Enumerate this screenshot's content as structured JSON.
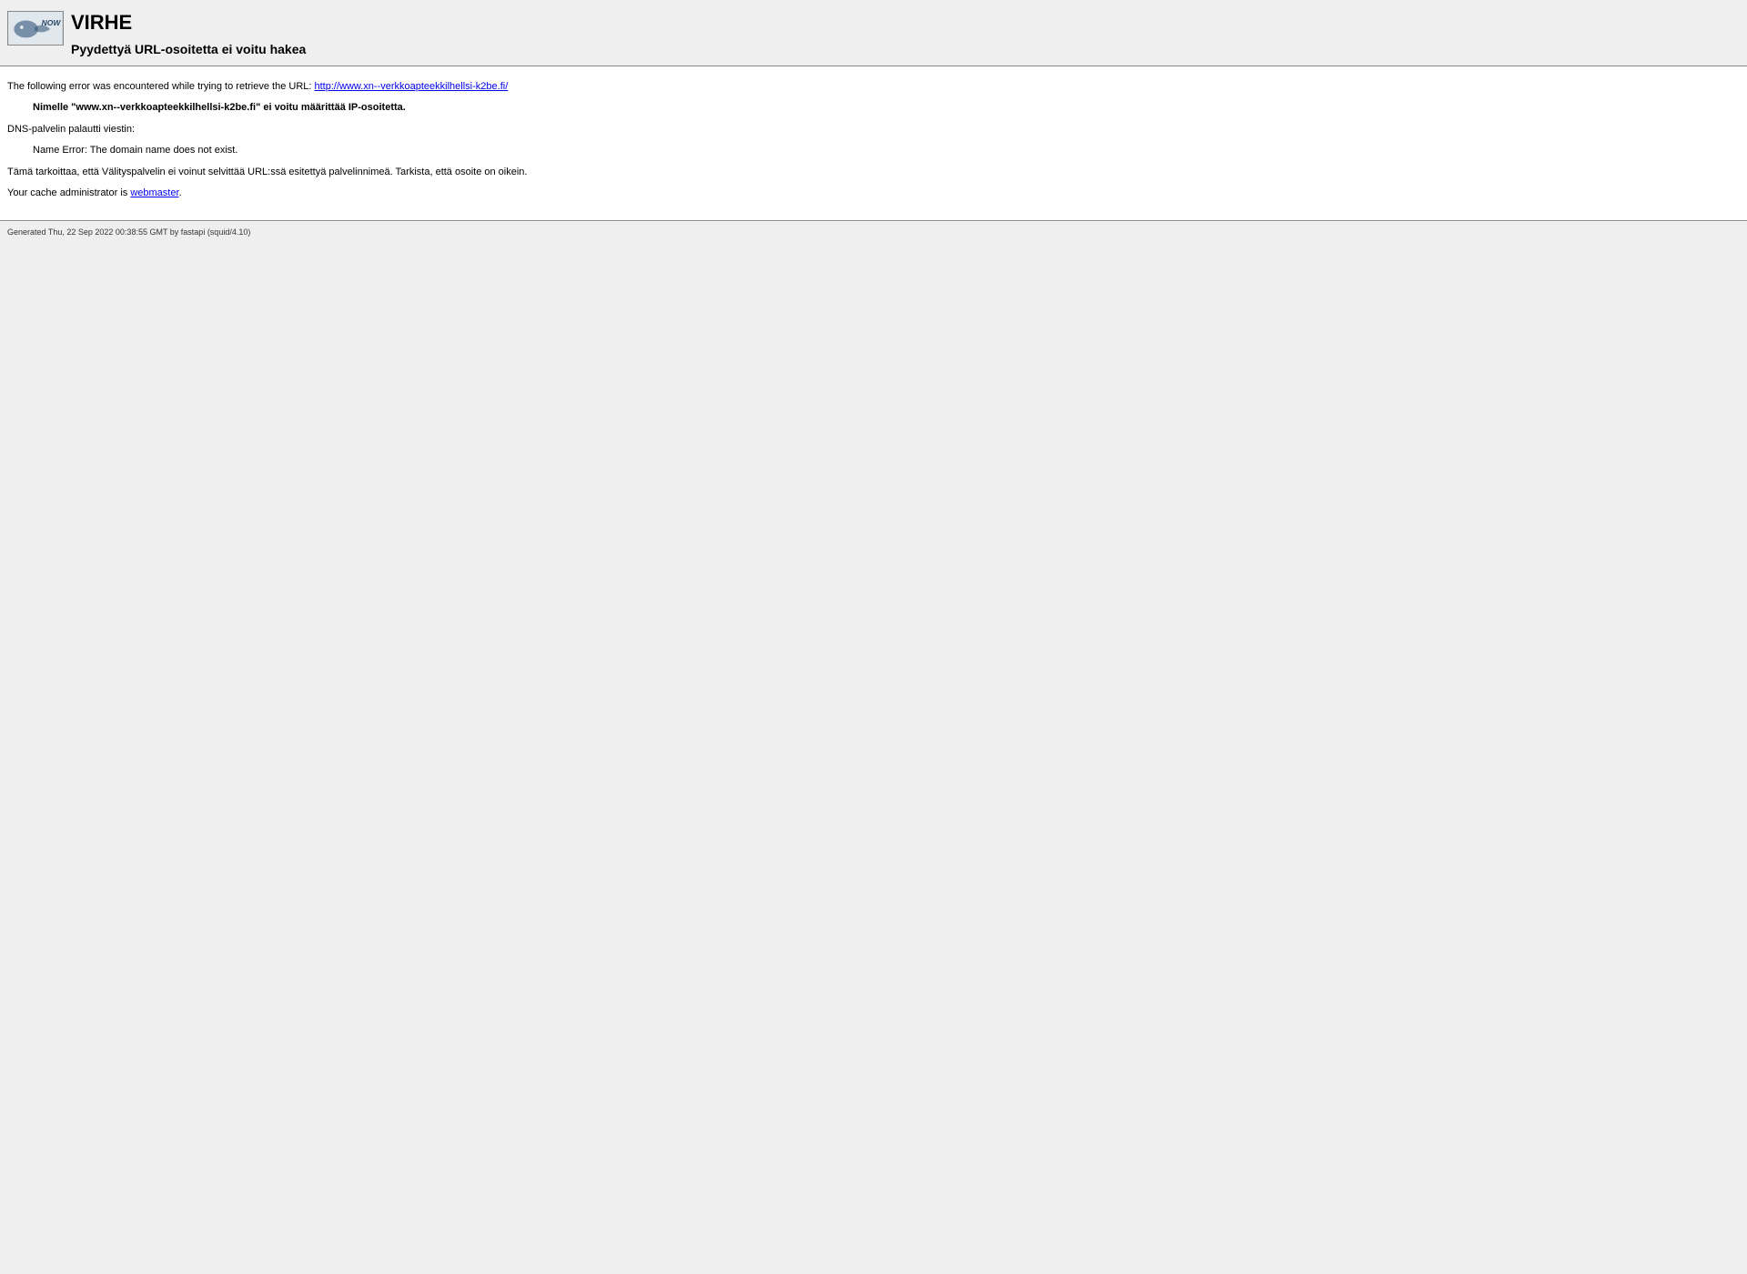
{
  "header": {
    "title": "VIRHE",
    "subtitle": "Pyydettyä URL-osoitetta ei voitu hakea"
  },
  "content": {
    "intro_text": "The following error was encountered while trying to retrieve the URL: ",
    "url_link": "http://www.xn--verkkoapteekkilhellsi-k2be.fi/",
    "error_bold": "Nimelle \"www.xn--verkkoapteekkilhellsi-k2be.fi\" ei voitu määrittää IP-osoitetta.",
    "dns_message_label": "DNS-palvelin palautti viestin:",
    "dns_error": "Name Error: The domain name does not exist.",
    "explanation": "Tämä tarkoittaa, että Välityspalvelin ei voinut selvittää URL:ssä esitettyä palvelinnimeä. Tarkista, että osoite on oikein.",
    "admin_text": "Your cache administrator is ",
    "admin_link": "webmaster",
    "admin_suffix": "."
  },
  "footer": {
    "generated": "Generated Thu, 22 Sep 2022 00:38:55 GMT by fastapi (squid/4.10)"
  }
}
